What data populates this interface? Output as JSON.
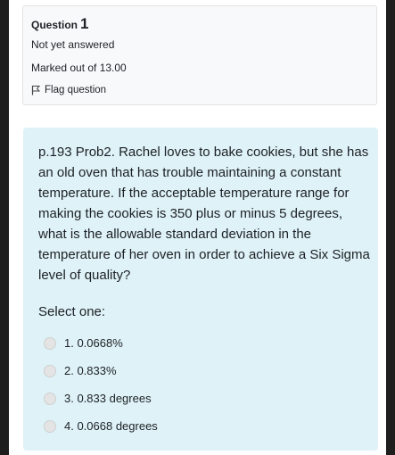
{
  "question_info": {
    "label": "Question",
    "number": "1",
    "state": "Not yet answered",
    "grade": "Marked out of 13.00",
    "flag_label": "Flag question"
  },
  "question": {
    "text": "p.193 Prob2. Rachel loves to bake cookies, but she has an old oven that has trouble maintaining a constant temperature. If the acceptable temperature range for making the cookies is 350 plus or minus 5 degrees, what is the allowable standard deviation in the temperature of her oven in order to achieve a Six Sigma level of quality?",
    "prompt": "Select one:",
    "options": [
      {
        "label": "1. 0.0668%"
      },
      {
        "label": "2. 0.833%"
      },
      {
        "label": "3. 0.833 degrees"
      },
      {
        "label": "4. 0.0668 degrees"
      }
    ]
  },
  "colors": {
    "info_bg": "#f8f9fa",
    "content_bg": "#def2f8",
    "text": "#1d2125"
  }
}
